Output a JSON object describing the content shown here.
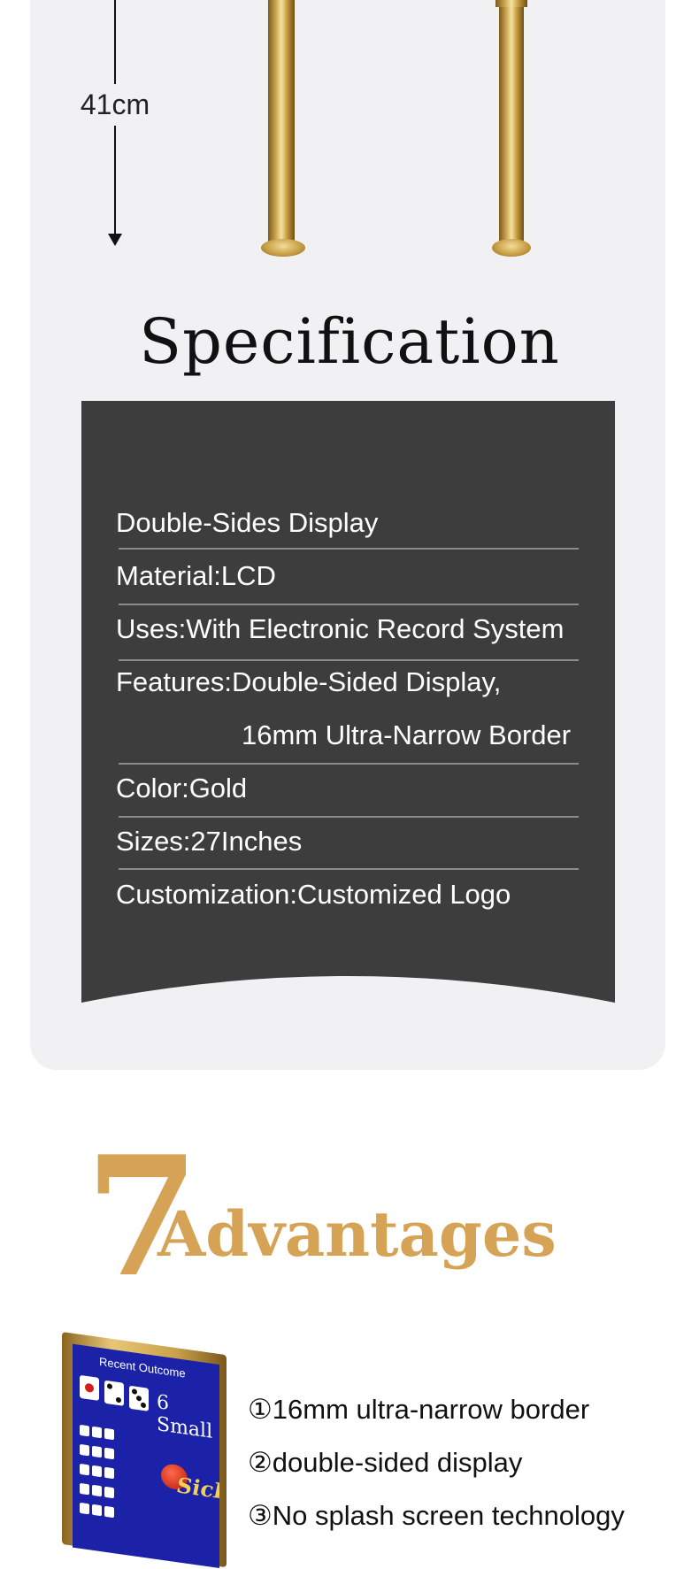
{
  "product": {
    "dimension_label": "41cm"
  },
  "specification": {
    "title": "Specification",
    "rows": [
      {
        "text": "Double-Sides Display"
      },
      {
        "text": "Material:LCD"
      },
      {
        "text": "Uses:With Electronic Record System"
      },
      {
        "text": "Features:Double-Sided Display,"
      },
      {
        "text": "16mm Ultra-Narrow Border"
      },
      {
        "text": "Color:Gold"
      },
      {
        "text": "Sizes:27Inches"
      },
      {
        "text": "Customization:Customized Logo"
      }
    ]
  },
  "advantages": {
    "number": "7",
    "title": "Advantages",
    "items": [
      "①16mm ultra-narrow border",
      "②double-sided display",
      "③No splash screen technology"
    ]
  },
  "device_screen": {
    "title": "Recent Outcome",
    "subtitle": "6 Small",
    "logo": "SicBo"
  },
  "colors": {
    "accent_gold": "#d6a356",
    "panel_bg": "#f1f1f3",
    "spec_box_bg": "#3d3d3d"
  }
}
